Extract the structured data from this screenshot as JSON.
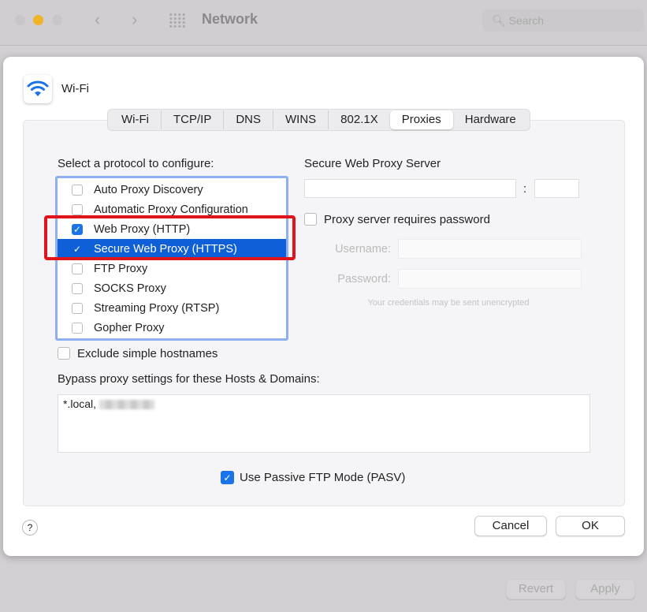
{
  "window": {
    "title": "Network",
    "search_placeholder": "Search",
    "revert": "Revert",
    "apply": "Apply"
  },
  "sheet": {
    "service": "Wi-Fi",
    "tabs": [
      {
        "label": "Wi-Fi"
      },
      {
        "label": "TCP/IP"
      },
      {
        "label": "DNS"
      },
      {
        "label": "WINS"
      },
      {
        "label": "802.1X"
      },
      {
        "label": "Proxies",
        "active": true
      },
      {
        "label": "Hardware"
      }
    ],
    "protocol_label": "Select a protocol to configure:",
    "protocols": [
      {
        "label": "Auto Proxy Discovery",
        "checked": false
      },
      {
        "label": "Automatic Proxy Configuration",
        "checked": false
      },
      {
        "label": "Web Proxy (HTTP)",
        "checked": true
      },
      {
        "label": "Secure Web Proxy (HTTPS)",
        "checked": true,
        "selected": true
      },
      {
        "label": "FTP Proxy",
        "checked": false
      },
      {
        "label": "SOCKS Proxy",
        "checked": false
      },
      {
        "label": "Streaming Proxy (RTSP)",
        "checked": false
      },
      {
        "label": "Gopher Proxy",
        "checked": false
      }
    ],
    "server_label": "Secure Web Proxy Server",
    "server_value": "",
    "port_value": "",
    "colon": ":",
    "requires_password": "Proxy server requires password",
    "requires_password_checked": false,
    "username_label": "Username:",
    "password_label": "Password:",
    "credentials_note": "Your credentials may be sent unencrypted",
    "exclude_simple": "Exclude simple hostnames",
    "exclude_simple_checked": false,
    "bypass_label": "Bypass proxy settings for these Hosts & Domains:",
    "bypass_value": "*.local,",
    "passive_ftp": "Use Passive FTP Mode (PASV)",
    "passive_ftp_checked": true,
    "help": "?",
    "cancel": "Cancel",
    "ok": "OK"
  },
  "colors": {
    "accent": "#1a73e8",
    "selection": "#0f5fd8",
    "highlight_box": "#e0141c"
  }
}
